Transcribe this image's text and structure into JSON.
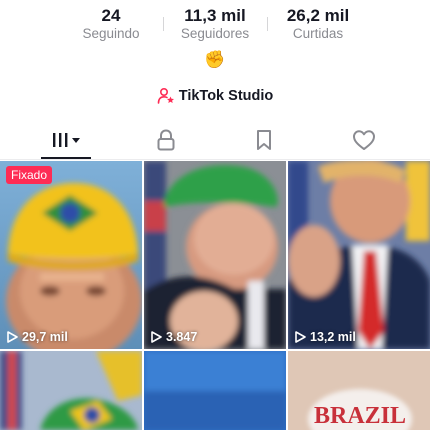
{
  "stats": {
    "following": {
      "value": "24",
      "label": "Seguindo"
    },
    "followers": {
      "value": "11,3 mil",
      "label": "Seguidores"
    },
    "likes": {
      "value": "26,2 mil",
      "label": "Curtidas"
    }
  },
  "bio": {
    "emoji": "✊"
  },
  "studio": {
    "label": "TikTok Studio",
    "icon": "person-star-icon",
    "icon_color": "#fe2c55"
  },
  "tabs": [
    {
      "name": "videos",
      "icon": "grid-icon",
      "active": true
    },
    {
      "name": "private",
      "icon": "lock-icon",
      "active": false
    },
    {
      "name": "saved",
      "icon": "bookmark-icon",
      "active": false
    },
    {
      "name": "liked",
      "icon": "heart-icon",
      "active": false
    }
  ],
  "videos": [
    {
      "badge": "Fixado",
      "views": "29,7 mil"
    },
    {
      "views": "3.847"
    },
    {
      "views": "13,2 mil"
    },
    {},
    {},
    {
      "caption": "BRAZIL"
    }
  ],
  "colors": {
    "accent": "#fe2c55",
    "text": "#161823",
    "muted": "#8a8b91"
  }
}
